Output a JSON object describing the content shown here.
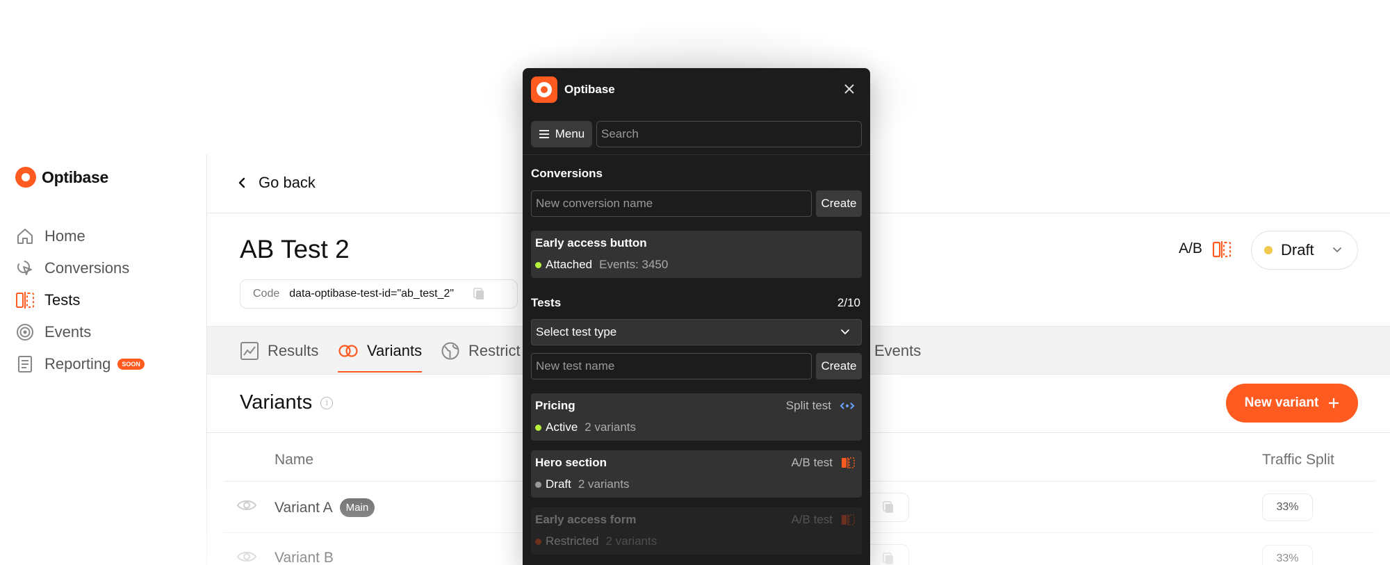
{
  "sidebar": {
    "brand": "Optibase",
    "items": [
      {
        "label": "Home",
        "icon": "home-icon"
      },
      {
        "label": "Conversions",
        "icon": "cursor-click-icon"
      },
      {
        "label": "Tests",
        "icon": "split-test-icon"
      },
      {
        "label": "Events",
        "icon": "target-icon"
      },
      {
        "label": "Reporting",
        "icon": "report-icon",
        "badge": "SOON"
      }
    ]
  },
  "header": {
    "back_label": "Go back",
    "title": "AB Test 2",
    "code_label": "Code",
    "code_value": "data-optibase-test-id=\"ab_test_2\"",
    "test_type": "A/B",
    "status": "Draft"
  },
  "tabs": [
    {
      "label": "Results"
    },
    {
      "label": "Variants"
    },
    {
      "label": "Restrict"
    },
    {
      "label": "Events"
    }
  ],
  "variants": {
    "heading": "Variants",
    "new_button": "New variant",
    "columns": {
      "name": "Name",
      "split": "Traffic Split"
    },
    "rows": [
      {
        "name": "Variant A",
        "badge": "Main",
        "split": "33%"
      },
      {
        "name": "Variant B",
        "split": "33%"
      }
    ]
  },
  "popup": {
    "title": "Optibase",
    "menu_label": "Menu",
    "search_placeholder": "Search",
    "conversions": {
      "heading": "Conversions",
      "input_placeholder": "New conversion name",
      "create_label": "Create",
      "items": [
        {
          "title": "Early access button",
          "status": "Attached",
          "meta": "Events: 3450",
          "dot": "#b5f23d"
        }
      ]
    },
    "tests": {
      "heading": "Tests",
      "count": "2/10",
      "select_placeholder": "Select test type",
      "input_placeholder": "New test name",
      "create_label": "Create",
      "items": [
        {
          "title": "Pricing",
          "type": "Split test",
          "status": "Active",
          "meta": "2 variants",
          "dot": "#b5f23d"
        },
        {
          "title": "Hero section",
          "type": "A/B test",
          "status": "Draft",
          "meta": "2 variants",
          "dot": "#9a9a9a"
        },
        {
          "title": "Early access form",
          "type": "A/B test",
          "status": "Restricted",
          "meta": "2 variants",
          "dot": "#ff5a1f"
        }
      ]
    }
  },
  "colors": {
    "accent": "#ff5a1f",
    "panel": "#1c1c1c",
    "card": "#333333"
  }
}
